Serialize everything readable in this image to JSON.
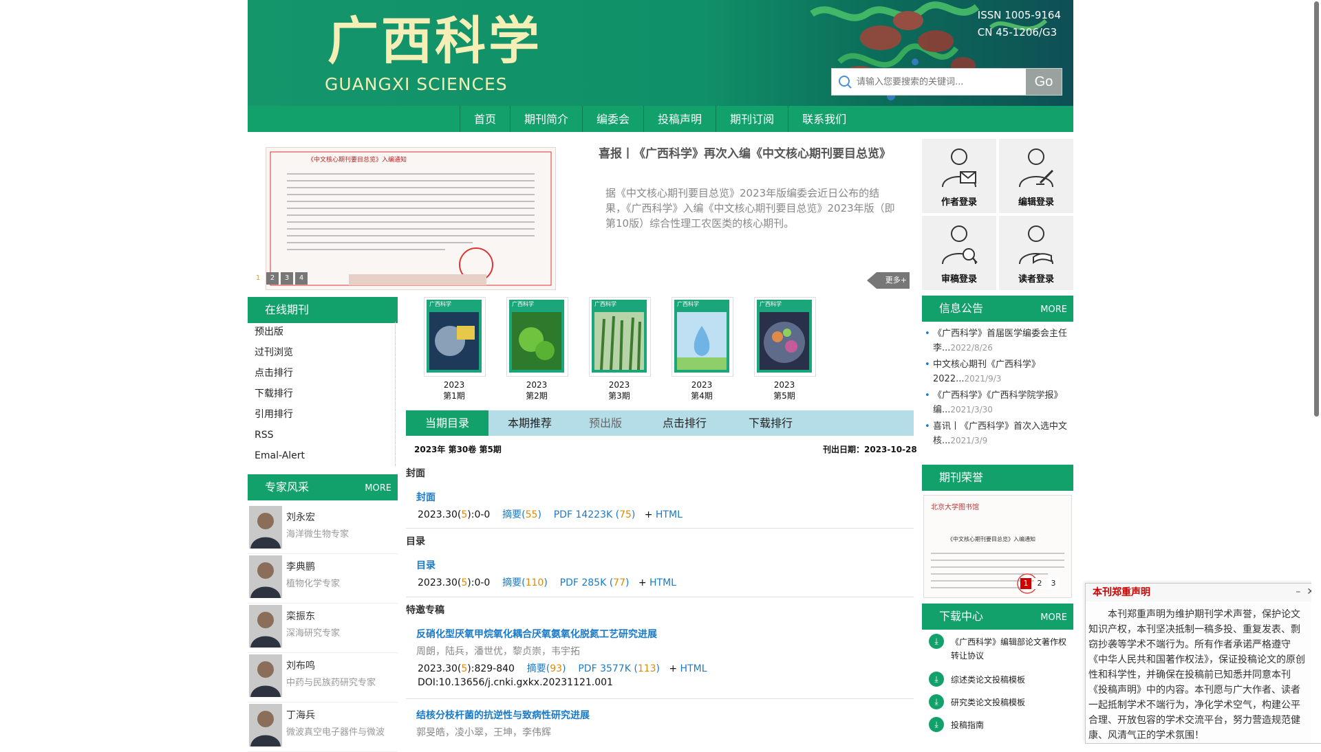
{
  "header": {
    "logo_cn": "广西科学",
    "logo_en": "GUANGXI SCIENCES",
    "issn": "ISSN 1005-9164",
    "cn": "CN  45-1206/G3",
    "search_placeholder": "请输入您要搜索的关键词...",
    "search_button": "Go"
  },
  "nav": [
    "首页",
    "期刊简介",
    "编委会",
    "投稿声明",
    "期刊订阅",
    "联系我们"
  ],
  "slider": {
    "pages": [
      "1",
      "2",
      "3",
      "4"
    ],
    "title": "喜报丨《广西科学》再次入编《中文核心期刊要目总览》",
    "body": "据《中文核心期刊要目总览》2023年版编委会近日公布的结果，《广西科学》入编《中文核心期刊要目总览》2023年版（即第10版）综合性理工农医类的核心期刊。",
    "more": "更多+"
  },
  "logins": [
    "作者登录",
    "编辑登录",
    "审稿登录",
    "读者登录"
  ],
  "online": {
    "title": "在线期刊",
    "items": [
      "预出版",
      "过刊浏览",
      "点击排行",
      "下载排行",
      "引用排行",
      "RSS",
      "Emal-Alert"
    ]
  },
  "experts": {
    "title": "专家风采",
    "more": "MORE",
    "items": [
      {
        "name": "刘永宏",
        "desc": "海洋微生物专家"
      },
      {
        "name": "李典鹏",
        "desc": "植物化学专家"
      },
      {
        "name": "栾振东",
        "desc": "深海研究专家"
      },
      {
        "name": "刘布鸣",
        "desc": "中药与民族药研究专家"
      },
      {
        "name": "丁海兵",
        "desc": "微波真空电子器件与微波"
      }
    ]
  },
  "covers": [
    {
      "year": "2023",
      "issue": "第1期"
    },
    {
      "year": "2023",
      "issue": "第2期"
    },
    {
      "year": "2023",
      "issue": "第3期"
    },
    {
      "year": "2023",
      "issue": "第4期"
    },
    {
      "year": "2023",
      "issue": "第5期"
    }
  ],
  "cover_brand": "广西科学",
  "tabs": [
    "当期目录",
    "本期推荐",
    "预出版",
    "点击排行",
    "下载排行"
  ],
  "issue": {
    "line": "2023年 第30卷 第5期",
    "date": "刊出日期：2023-10-28"
  },
  "articles": {
    "sec1": "封面",
    "a1_title": "封面",
    "a1_cite": "2023.30(",
    "a1_no": "5",
    "a1_pages": "):0-0",
    "a1_abs": "摘要(",
    "a1_absn": "55",
    "a1_pdf": "PDF 14223K (",
    "a1_pdfn": "75",
    "a1_html": "HTML",
    "sec2": "目录",
    "a2_title": "目录",
    "a2_cite": "2023.30(",
    "a2_no": "5",
    "a2_pages": "):0-0",
    "a2_abs": "摘要(",
    "a2_absn": "110",
    "a2_pdf": "PDF 285K (",
    "a2_pdfn": "77",
    "a2_html": "HTML",
    "sec3": "特邀专稿",
    "a3_title": "反硝化型厌氧甲烷氧化耦合厌氧氨氧化脱氮工艺研究进展",
    "a3_authors": "周朗，陆兵，潘世优，黎贞崇，韦宇拓",
    "a3_cite": "2023.30(",
    "a3_no": "5",
    "a3_pages": "):829-840",
    "a3_abs": "摘要(",
    "a3_absn": "93",
    "a3_pdf": "PDF 3577K (",
    "a3_pdfn": "113",
    "a3_html": "HTML",
    "a3_doi": "DOI:10.13656/j.cnki.gxkx.20231121.001",
    "a4_title": "结核分枝杆菌的抗逆性与致病性研究进展",
    "a4_authors": "郭旻皓，凌小翠，王坤，李伟辉"
  },
  "notices": {
    "title": "信息公告",
    "more": "MORE",
    "items": [
      {
        "text": "《广西科学》首届医学编委会主任李...",
        "date": "2022/8/26"
      },
      {
        "text": "中文核心期刊《广西科学》2022...",
        "date": "2021/9/3"
      },
      {
        "text": "《广西科学》《广西科学院学报》编...",
        "date": "2021/3/30"
      },
      {
        "text": "喜讯丨《广西科学》首次入选中文核...",
        "date": "2021/3/9"
      }
    ]
  },
  "honor": {
    "title": "期刊荣誉",
    "pages": [
      "1",
      "2",
      "3"
    ],
    "doc_title": "《中文核心期刊要目总览》入编通知"
  },
  "downloads": {
    "title": "下载中心",
    "more": "MORE",
    "items": [
      "《广西科学》编辑部论文著作权转让协议",
      "综述类论文投稿模板",
      "研究类论文投稿模板",
      "投稿指南"
    ]
  },
  "popup": {
    "title": "本刊郑重声明",
    "body": "本刊郑重声明为维护期刊学术声誉，保护论文知识产权，本刊坚决抵制一稿多投、重复发表、剽窃抄袭等学术不端行为。所有作者承诺严格遵守《中华人民共和国著作权法》，保证投稿论文的原创性和科学性，并确保在投稿前已知悉并同意本刊《投稿声明》中的内容。本刊愿与广大作者、读者一起抵制学术不端行为，净化学术空气，构建公平合理、开放包容的学术交流平台，努力营造规范健康、风清气正的学术氛围！"
  }
}
